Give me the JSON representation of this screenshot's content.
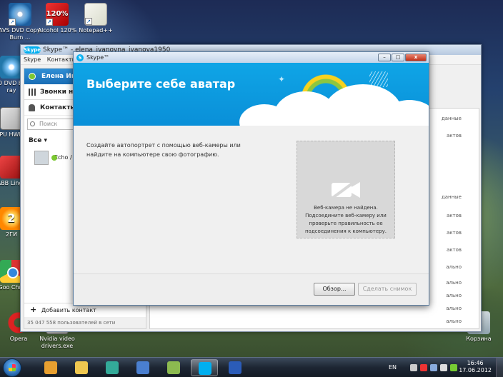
{
  "desktop": {
    "icons_top": [
      {
        "label": "AVS DVD Copy. Burn ...",
        "icon": "avs-dvd-icon"
      },
      {
        "label": "Alcohol 120%",
        "icon": "alcohol-icon",
        "badge": "120%"
      },
      {
        "label": "Notepad++",
        "icon": "notepad-icon"
      }
    ],
    "icons_left": [
      {
        "label": "GO DVD Blu-ray",
        "icon": "disk-icon"
      },
      {
        "label": "CPU HWMo",
        "icon": "cpu-icon"
      },
      {
        "label": "ABB Lingv",
        "icon": "abbyy-icon"
      },
      {
        "label": "2ГИ",
        "icon": "2gis-icon",
        "glyph": "2"
      },
      {
        "label": "Goo Chro",
        "icon": "chrome-icon"
      }
    ],
    "icons_bottom": [
      {
        "label": "Opera",
        "icon": "opera-icon"
      },
      {
        "label": "Nvidia video drivers.exe",
        "icon": "nvidia-icon"
      },
      {
        "label": "Корзина",
        "icon": "recycle-bin-icon"
      }
    ]
  },
  "skype_main": {
    "title": "Skype™ - elena_ivanovna_ivanova1950",
    "logo": "Skype",
    "menu": [
      "Skype",
      "Контакты"
    ],
    "user_name": "Елена Ив",
    "calls_label": "Звонки на",
    "contacts_label": "Контакты",
    "search_placeholder": "Поиск",
    "all_label": "Все",
    "contacts": [
      {
        "name": "Echo /"
      }
    ],
    "add_contact": "Добавить контакт",
    "users_online": "35 047 558 пользователей в сети",
    "right_fragments": [
      "данные",
      "актов",
      "данные",
      "актов",
      "актов",
      "актов",
      "ально",
      "ально",
      "ально",
      "ально",
      "ально"
    ]
  },
  "dialog": {
    "title": "Skype™",
    "heading": "Выберите себе аватар",
    "body": "Создайте автопортрет с помощью веб-камеры или найдите на компьютере свою фотографию.",
    "camera_message": "Веб-камера не найдена. Подсоедините веб-камеру или проверьте правильность ее подсоединения к компьютеру.",
    "browse_button": "Обзор...",
    "snapshot_button": "Сделать снимок",
    "controls": {
      "minimize": "–",
      "maximize": "□",
      "close": "x"
    }
  },
  "taskbar": {
    "apps": [
      {
        "name": "media-player-icon",
        "color": "#e8a030"
      },
      {
        "name": "explorer-icon",
        "color": "#f0c850"
      },
      {
        "name": "chrome-icon",
        "color": "#3a9"
      },
      {
        "name": "network-icon",
        "color": "#4a7fd0"
      },
      {
        "name": "tool-icon",
        "color": "#8cba50"
      },
      {
        "name": "skype-icon",
        "color": "#00aff0",
        "active": true
      },
      {
        "name": "word-icon",
        "color": "#2b5cb8"
      }
    ],
    "language": "EN",
    "time": "16:46",
    "date": "17.06.2012"
  }
}
